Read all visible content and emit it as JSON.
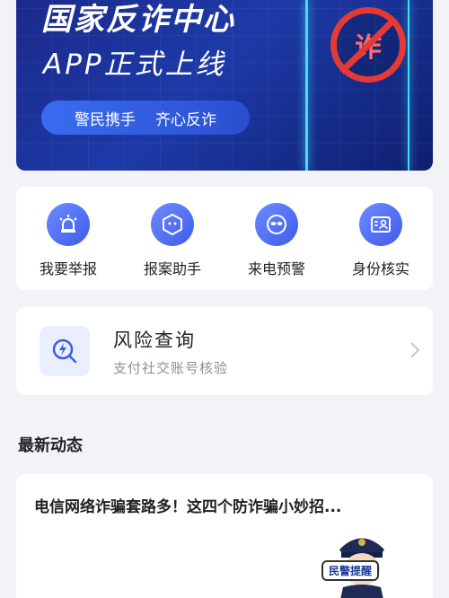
{
  "banner": {
    "title": "国家反诈中心",
    "subtitle": "APP正式上线",
    "slogan_left": "警民携手",
    "slogan_right": "齐心反诈",
    "badge_text": "诈"
  },
  "actions": [
    {
      "label": "我要举报",
      "icon": "alarm-icon"
    },
    {
      "label": "报案助手",
      "icon": "hexagon-face-icon"
    },
    {
      "label": "来电预警",
      "icon": "mask-icon"
    },
    {
      "label": "身份核实",
      "icon": "id-card-icon"
    }
  ],
  "risk": {
    "title": "风险查询",
    "subtitle": "支付社交账号核验",
    "icon": "search-lightning-icon"
  },
  "section": {
    "title": "最新动态"
  },
  "news": {
    "title": "电信网络诈骗套路多！这四个防诈骗小妙招...",
    "stamp": "民警提醒"
  },
  "colors": {
    "accent": "#3f5bea",
    "banner": "#1d3aa8",
    "alert": "#e53935"
  }
}
